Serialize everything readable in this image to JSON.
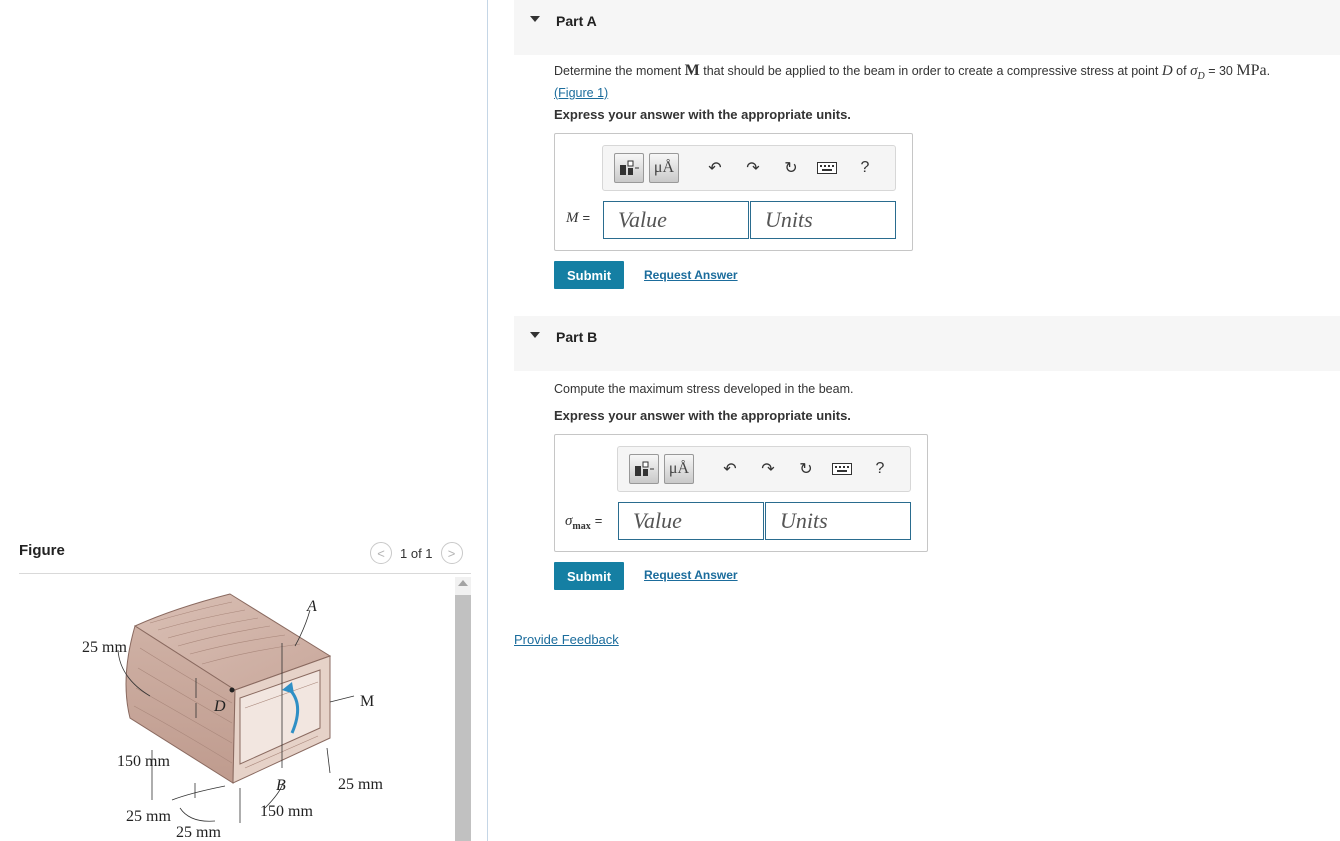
{
  "figure": {
    "label": "Figure",
    "pager": {
      "count": "1 of 1",
      "prev_glyph": "<",
      "next_glyph": ">"
    },
    "labels": {
      "top_thickness": "25 mm",
      "left_height": "150 mm",
      "bottom_left": "25 mm",
      "bottom_mid": "25 mm",
      "bottom_width": "150 mm",
      "right_thickness": "25 mm",
      "moment": "M",
      "point_a": "A",
      "point_b": "B",
      "point_d": "D"
    }
  },
  "part_a": {
    "title": "Part A",
    "question_pre": "Determine the moment",
    "question_moment": "M",
    "question_mid": "that should be applied to the beam in order to create a compressive stress at point",
    "question_point": "D",
    "question_of": "of",
    "question_sigma": "σ",
    "question_sub": "D",
    "question_eq": "= 30",
    "question_unit": "MPa",
    "question_end": ".",
    "figure_link": "(Figure 1)",
    "instruction": "Express your answer with the appropriate units.",
    "variable": "M",
    "equals": "=",
    "value_placeholder": "Value",
    "units_placeholder": "Units",
    "submit_label": "Submit",
    "request_label": "Request Answer"
  },
  "part_b": {
    "title": "Part B",
    "question": "Compute the maximum stress developed in the beam.",
    "instruction": "Express your answer with the appropriate units.",
    "variable": "σ",
    "variable_sub": "max",
    "equals": "=",
    "value_placeholder": "Value",
    "units_placeholder": "Units",
    "submit_label": "Submit",
    "request_label": "Request Answer"
  },
  "toolbar": {
    "mu_label": "μÅ",
    "help_label": "?"
  },
  "feedback_link": "Provide Feedback",
  "colors": {
    "submit": "#157fa3",
    "link": "#1b6c9c",
    "field_border": "#2a6c8f",
    "header_bg": "#f6f6f6"
  }
}
